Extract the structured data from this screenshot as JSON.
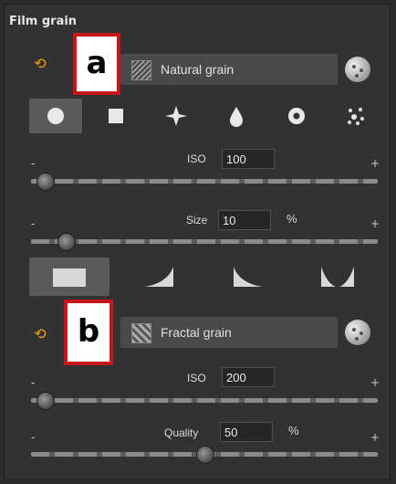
{
  "panel_title": "Film grain",
  "annotations": {
    "a": "a",
    "b": "b"
  },
  "grain_1": {
    "type_label": "Natural grain",
    "iso": {
      "label": "ISO",
      "value": "100",
      "minus": "-",
      "plus": "+",
      "level": 0.04
    },
    "size": {
      "label": "Size",
      "value": "10",
      "unit": "%",
      "minus": "-",
      "plus": "+",
      "level": 0.1
    }
  },
  "grain_2": {
    "type_label": "Fractal grain",
    "iso": {
      "label": "ISO",
      "value": "200",
      "minus": "-",
      "plus": "+",
      "level": 0.04
    },
    "quality": {
      "label": "Quality",
      "value": "50",
      "unit": "%",
      "minus": "-",
      "plus": "+",
      "level": 0.5
    }
  },
  "shapes": [
    "circle",
    "square",
    "star",
    "drop",
    "ring",
    "dots"
  ],
  "curves": [
    "flat",
    "ramp-up",
    "ramp-down",
    "valley"
  ],
  "colors": {
    "accent": "#f2a100",
    "annotation_border": "#c6161b"
  }
}
